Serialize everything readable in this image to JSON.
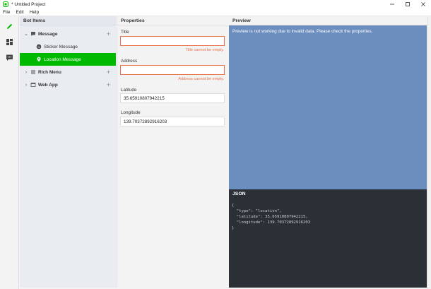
{
  "window": {
    "title": "* Untitled Project",
    "controls": [
      "minimize-icon",
      "maximize-icon",
      "close-icon"
    ]
  },
  "menu": [
    "File",
    "Edit",
    "Help"
  ],
  "sidebar_icons": [
    {
      "name": "pencil-icon",
      "color": "#00b900"
    },
    {
      "name": "dashboard-icon",
      "color": "#444444"
    },
    {
      "name": "chat-icon",
      "color": "#444444"
    }
  ],
  "bot_items": {
    "title": "Bot Items",
    "tree": [
      {
        "label": "Message",
        "icon": "message-icon",
        "expanded": true,
        "level": 0
      },
      {
        "label": "Sticker Message",
        "icon": "sticker-icon",
        "level": 1
      },
      {
        "label": "Location Message",
        "icon": "location-icon",
        "level": 1,
        "selected": true
      },
      {
        "label": "Rich Menu",
        "icon": "list-icon",
        "expanded": false,
        "level": 0
      },
      {
        "label": "Web App",
        "icon": "window-icon",
        "expanded": false,
        "level": 0
      }
    ],
    "selected_color": "#00b900"
  },
  "properties": {
    "title": "Properties",
    "title_label": "Title",
    "title_value": "",
    "title_error": "Title cannot be empty.",
    "address_label": "Address",
    "address_value": "",
    "address_error": "Address cannot be empty.",
    "latitude_label": "Latitude",
    "latitude_value": "35.65910807942215",
    "longitude_label": "Longitude",
    "longitude_value": "139.70372892916203",
    "error_color": "#e8734a"
  },
  "preview": {
    "title": "Preview",
    "message": "Preview is not working due to invalid data. Please check the properties.",
    "bg_color": "#6b8ebf"
  },
  "json_panel": {
    "title": "JSON",
    "lines": [
      "{",
      "  \"type\": \"location\",",
      "  \"latitude\": 35.65910807942215,",
      "  \"longitude\": 139.70372892916203",
      "}"
    ],
    "bg_color": "#2b2f36"
  }
}
